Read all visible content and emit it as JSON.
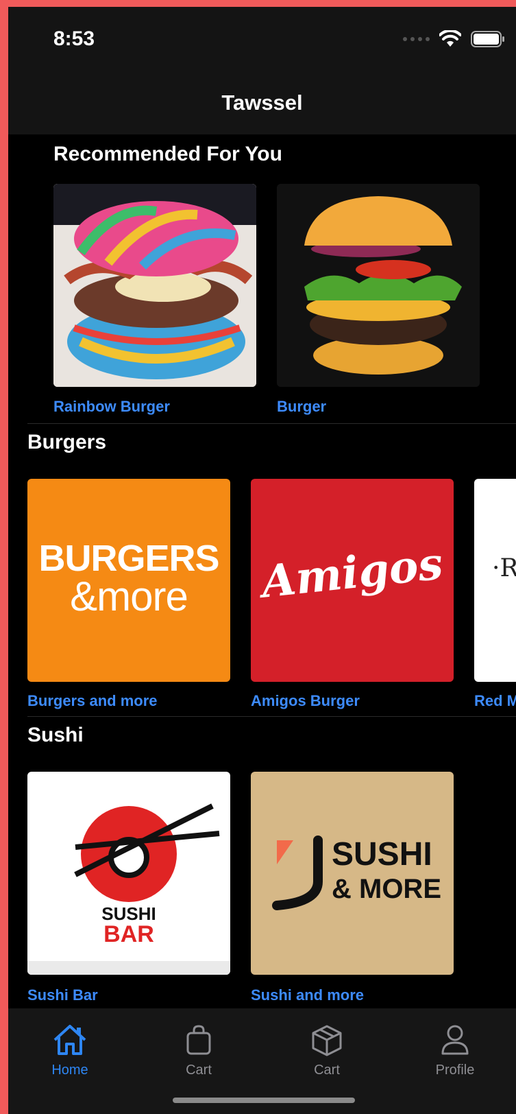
{
  "status_bar": {
    "time": "8:53"
  },
  "nav": {
    "title": "Tawssel"
  },
  "recommended": {
    "title": "Recommended For You",
    "items": [
      {
        "label": "Rainbow Burger"
      },
      {
        "label": "Burger"
      }
    ]
  },
  "burgers": {
    "title": "Burgers",
    "items": [
      {
        "label": "Burgers and more",
        "logo_line1": "BURGERS",
        "logo_line2": "&more"
      },
      {
        "label": "Amigos Burger",
        "logo": "Amigos"
      },
      {
        "label": "Red M",
        "logo": "·R"
      }
    ]
  },
  "sushi": {
    "title": "Sushi",
    "items": [
      {
        "label": "Sushi Bar",
        "logo_line1": "SUSHI",
        "logo_line2": "BAR"
      },
      {
        "label": "Sushi and more",
        "logo_line1": "SUSHI",
        "logo_line2": "& MORE"
      }
    ]
  },
  "tabs": [
    {
      "label": "Home",
      "icon": "home-icon",
      "active": true
    },
    {
      "label": "Cart",
      "icon": "bag-icon",
      "active": false
    },
    {
      "label": "Cart",
      "icon": "box-icon",
      "active": false
    },
    {
      "label": "Profile",
      "icon": "person-icon",
      "active": false
    }
  ],
  "colors": {
    "accent": "#2e86f3",
    "link": "#3d8bfd",
    "background": "#000000"
  }
}
